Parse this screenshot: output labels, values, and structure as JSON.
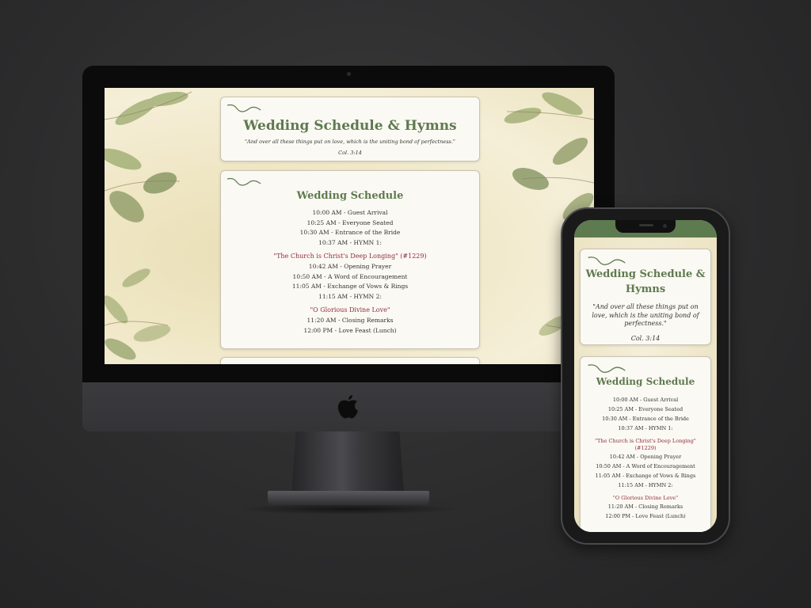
{
  "site": {
    "title": "Wedding Schedule & Hymns",
    "quote": "\"And over all these things put on love, which is the uniting bond of perfectness.\"",
    "reference": "Col. 3:14"
  },
  "schedule": {
    "heading": "Wedding Schedule",
    "group1": [
      "10:00 AM - Guest Arrival",
      "10:25 AM - Everyone Seated",
      "10:30 AM - Entrance of the Bride",
      "10:37 AM - HYMN 1:"
    ],
    "hymn1": "\"The Church is Christ's Deep Longing\" (#1229)",
    "group2": [
      "10:42 AM - Opening Prayer",
      "10:50 AM - A Word of Encouragement",
      "11:05 AM - Exchange of Vows & Rings",
      "11:15 AM - HYMN 2:"
    ],
    "hymn2": "\"O Glorious Divine Love\"",
    "group3": [
      "11:20 AM - Closing Remarks",
      "12:00 PM - Love Feast (Lunch)"
    ]
  },
  "colors": {
    "accent_green": "#5e7a4f",
    "hymn_red": "#8e2c3c",
    "card_bg": "#fbf9f3"
  },
  "icons": [
    "apple-logo-icon",
    "leaf-flourish-icon"
  ]
}
